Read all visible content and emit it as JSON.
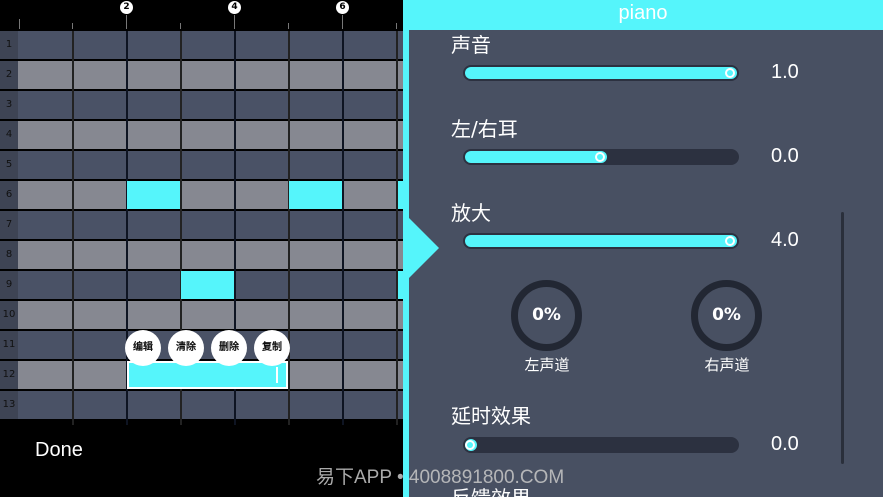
{
  "timeline": {
    "markers": [
      "2",
      "4",
      "6"
    ]
  },
  "rows": [
    "1",
    "2",
    "3",
    "4",
    "5",
    "6",
    "7",
    "8",
    "9",
    "10",
    "11",
    "12",
    "13"
  ],
  "context_menu": {
    "edit": "编辑",
    "clear": "清除",
    "delete": "删除",
    "copy": "复制"
  },
  "bottom": {
    "done_label": "Done"
  },
  "panel": {
    "title": "piano",
    "sound": {
      "label": "声音",
      "value_text": "1.0",
      "level": 1.0
    },
    "pan": {
      "label": "左/右耳",
      "value_text": "0.0",
      "level": 0.5
    },
    "amplify": {
      "label": "放大",
      "value_text": "4.0",
      "level": 1.0
    },
    "left_channel": {
      "percent": "0%",
      "label": "左声道"
    },
    "right_channel": {
      "percent": "0%",
      "label": "右声道"
    },
    "delay": {
      "label": "延时效果",
      "value_text": "0.0",
      "level": 0.0
    },
    "feedback": {
      "label": "反馈效果"
    }
  },
  "colors": {
    "accent": "#55f5fb",
    "panel_bg": "#485062",
    "row_dark": "#4a5266",
    "row_light": "#868891"
  },
  "watermark": "易下APP • 4008891800.COM"
}
